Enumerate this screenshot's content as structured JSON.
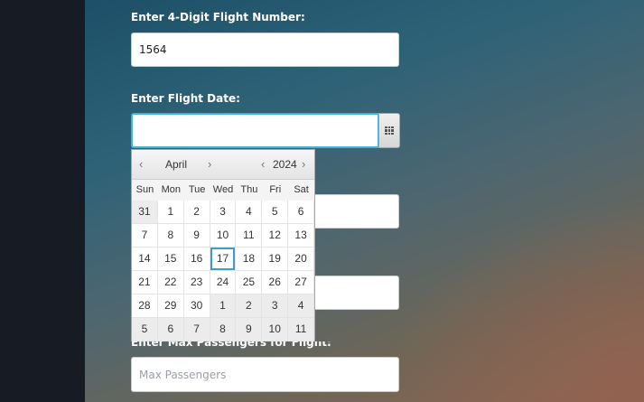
{
  "form": {
    "flight_number_label": "Enter 4-Digit Flight Number:",
    "flight_number_value": "1564",
    "flight_date_label": "Enter Flight Date:",
    "flight_date_value": "",
    "max_passengers_label": "Enter Max Passengers for Flight:",
    "max_passengers_placeholder": "Max Passengers"
  },
  "calendar": {
    "month": "April",
    "year": "2024",
    "prev_symbol": "‹",
    "next_symbol": "›",
    "days_of_week": [
      "Sun",
      "Mon",
      "Tue",
      "Wed",
      "Thu",
      "Fri",
      "Sat"
    ],
    "today": 17,
    "weeks": [
      [
        {
          "d": "31",
          "other": true
        },
        {
          "d": "1"
        },
        {
          "d": "2"
        },
        {
          "d": "3"
        },
        {
          "d": "4"
        },
        {
          "d": "5"
        },
        {
          "d": "6"
        }
      ],
      [
        {
          "d": "7"
        },
        {
          "d": "8"
        },
        {
          "d": "9"
        },
        {
          "d": "10"
        },
        {
          "d": "11"
        },
        {
          "d": "12"
        },
        {
          "d": "13"
        }
      ],
      [
        {
          "d": "14"
        },
        {
          "d": "15"
        },
        {
          "d": "16"
        },
        {
          "d": "17",
          "today": true
        },
        {
          "d": "18"
        },
        {
          "d": "19"
        },
        {
          "d": "20"
        }
      ],
      [
        {
          "d": "21"
        },
        {
          "d": "22"
        },
        {
          "d": "23"
        },
        {
          "d": "24"
        },
        {
          "d": "25"
        },
        {
          "d": "26"
        },
        {
          "d": "27"
        }
      ],
      [
        {
          "d": "28"
        },
        {
          "d": "29"
        },
        {
          "d": "30"
        },
        {
          "d": "1",
          "other": true
        },
        {
          "d": "2",
          "other": true
        },
        {
          "d": "3",
          "other": true
        },
        {
          "d": "4",
          "other": true
        }
      ],
      [
        {
          "d": "5",
          "other": true
        },
        {
          "d": "6",
          "other": true
        },
        {
          "d": "7",
          "other": true
        },
        {
          "d": "8",
          "other": true
        },
        {
          "d": "9",
          "other": true
        },
        {
          "d": "10",
          "other": true
        },
        {
          "d": "11",
          "other": true
        }
      ]
    ]
  },
  "colors": {
    "focus_border": "#45b1d8",
    "label_text": "#ffffff"
  }
}
